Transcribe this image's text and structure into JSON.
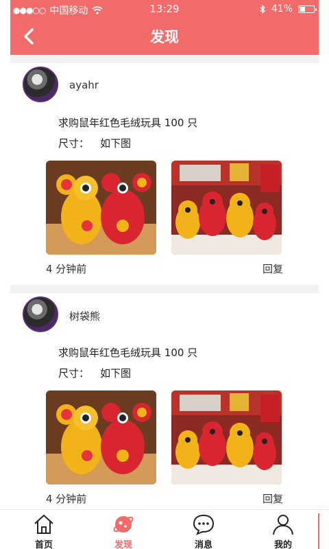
{
  "status_bar": {
    "signal": "●●●○○",
    "carrier": "中国移动",
    "time": "13:29",
    "battery": "41%"
  },
  "header": {
    "title": "发现"
  },
  "posts": [
    {
      "username": "ayahr",
      "text": "求购鼠年红色毛绒玩具 100 只",
      "size_label": "尺寸：",
      "size_value": "如下图",
      "time": "4 分钟前",
      "reply": "回复"
    },
    {
      "username": "树袋熊",
      "text": "求购鼠年红色毛绒玩具 100 只",
      "size_label": "尺寸：",
      "size_value": "如下图",
      "time": "4 分钟前",
      "reply": "回复"
    }
  ],
  "tabs": [
    {
      "label": "首页",
      "icon": "home-icon"
    },
    {
      "label": "发现",
      "icon": "planet-icon",
      "active": true
    },
    {
      "label": "消息",
      "icon": "chat-bubble-icon"
    },
    {
      "label": "我的",
      "icon": "user-icon"
    }
  ],
  "colors": {
    "accent": "#F26B6B"
  }
}
